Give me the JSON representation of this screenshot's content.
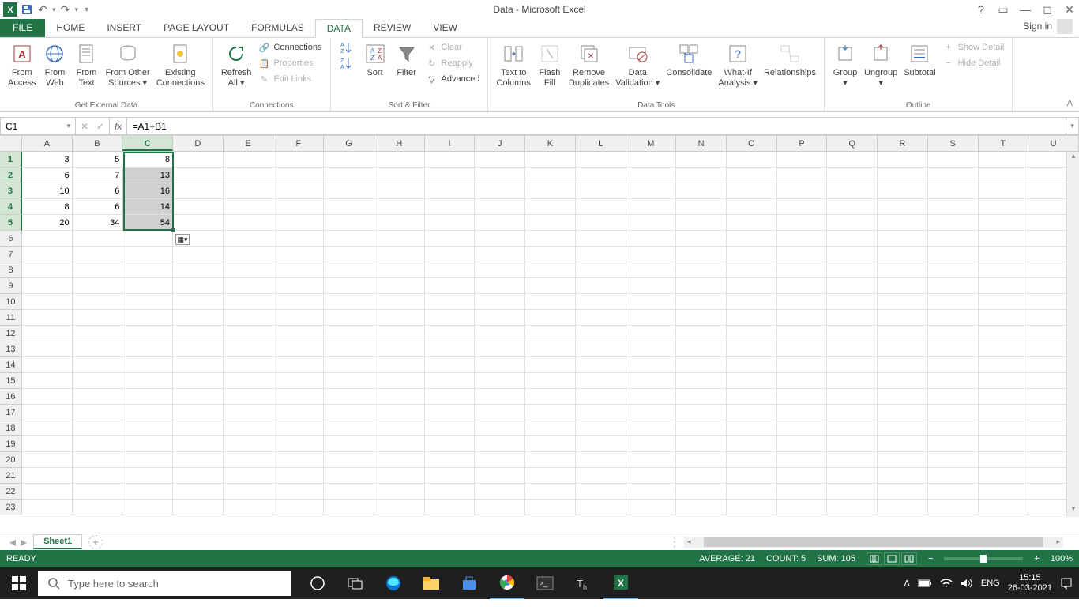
{
  "title": "Data - Microsoft Excel",
  "qat": {
    "undo": "↶",
    "redo": "↷"
  },
  "signin": "Sign in",
  "tabs": [
    "HOME",
    "INSERT",
    "PAGE LAYOUT",
    "FORMULAS",
    "DATA",
    "REVIEW",
    "VIEW"
  ],
  "file_tab": "FILE",
  "active_tab": "DATA",
  "ribbon": {
    "external": {
      "label": "Get External Data",
      "access": "From\nAccess",
      "web": "From\nWeb",
      "text": "From\nText",
      "other": "From Other\nSources ▾",
      "existing": "Existing\nConnections"
    },
    "connections": {
      "label": "Connections",
      "refresh": "Refresh\nAll ▾",
      "conn": "Connections",
      "prop": "Properties",
      "edit": "Edit Links"
    },
    "sort": {
      "label": "Sort & Filter",
      "sort": "Sort",
      "filter": "Filter",
      "clear": "Clear",
      "reapply": "Reapply",
      "advanced": "Advanced"
    },
    "tools": {
      "label": "Data Tools",
      "ttc": "Text to\nColumns",
      "flash": "Flash\nFill",
      "remdup": "Remove\nDuplicates",
      "valid": "Data\nValidation ▾",
      "consol": "Consolidate",
      "whatif": "What-If\nAnalysis ▾",
      "rel": "Relationships"
    },
    "outline": {
      "label": "Outline",
      "group": "Group\n▾",
      "ungroup": "Ungroup\n▾",
      "subtotal": "Subtotal",
      "showd": "Show Detail",
      "hided": "Hide Detail"
    }
  },
  "name_box": "C1",
  "formula": "=A1+B1",
  "columns": [
    "A",
    "B",
    "C",
    "D",
    "E",
    "F",
    "G",
    "H",
    "I",
    "J",
    "K",
    "L",
    "M",
    "N",
    "O",
    "P",
    "Q",
    "R",
    "S",
    "T",
    "U"
  ],
  "row_count": 23,
  "selected_col": "C",
  "selected_rows": [
    1,
    2,
    3,
    4,
    5
  ],
  "cells": {
    "A1": "3",
    "B1": "5",
    "C1": "8",
    "A2": "6",
    "B2": "7",
    "C2": "13",
    "A3": "10",
    "B3": "6",
    "C3": "16",
    "A4": "8",
    "B4": "6",
    "C4": "14",
    "A5": "20",
    "B5": "34",
    "C5": "54"
  },
  "sheet_tab": "Sheet1",
  "status": {
    "ready": "READY",
    "avg": "AVERAGE: 21",
    "count": "COUNT: 5",
    "sum": "SUM: 105",
    "zoom": "100%"
  },
  "taskbar": {
    "search_placeholder": "Type here to search",
    "lang": "ENG",
    "time": "15:15",
    "date": "26-03-2021"
  }
}
